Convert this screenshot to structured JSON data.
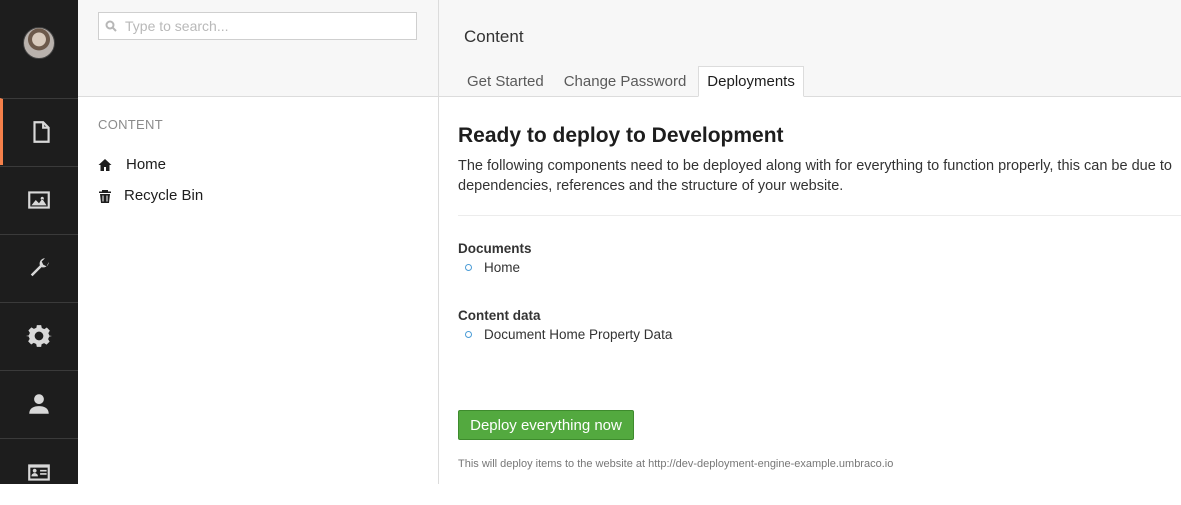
{
  "search": {
    "placeholder": "Type to search..."
  },
  "tree": {
    "section_label": "CONTENT",
    "nodes": [
      {
        "label": "Home",
        "icon": "home-icon"
      },
      {
        "label": "Recycle Bin",
        "icon": "trash-icon"
      }
    ]
  },
  "rail": {
    "items": [
      "content-icon",
      "media-icon",
      "wrench-icon",
      "gear-icon",
      "user-icon",
      "contact-card-icon"
    ],
    "active": "content-icon",
    "accent": "#f5804a"
  },
  "main": {
    "title": "Content",
    "tabs": [
      {
        "label": "Get Started"
      },
      {
        "label": "Change Password"
      },
      {
        "label": "Deployments",
        "active": true
      }
    ],
    "heading": "Ready to deploy to Development",
    "description": "The following components need to be deployed along with for everything to function properly, this can be due to dependencies, references and the structure of your website.",
    "groups": [
      {
        "title": "Documents",
        "items": [
          "Home"
        ]
      },
      {
        "title": "Content data",
        "items": [
          "Document Home Property Data"
        ]
      }
    ],
    "deploy_button": "Deploy everything now",
    "deploy_button_color": "#53a93f",
    "footnote": "This will deploy items to the website at http://dev-deployment-engine-example.umbraco.io"
  }
}
